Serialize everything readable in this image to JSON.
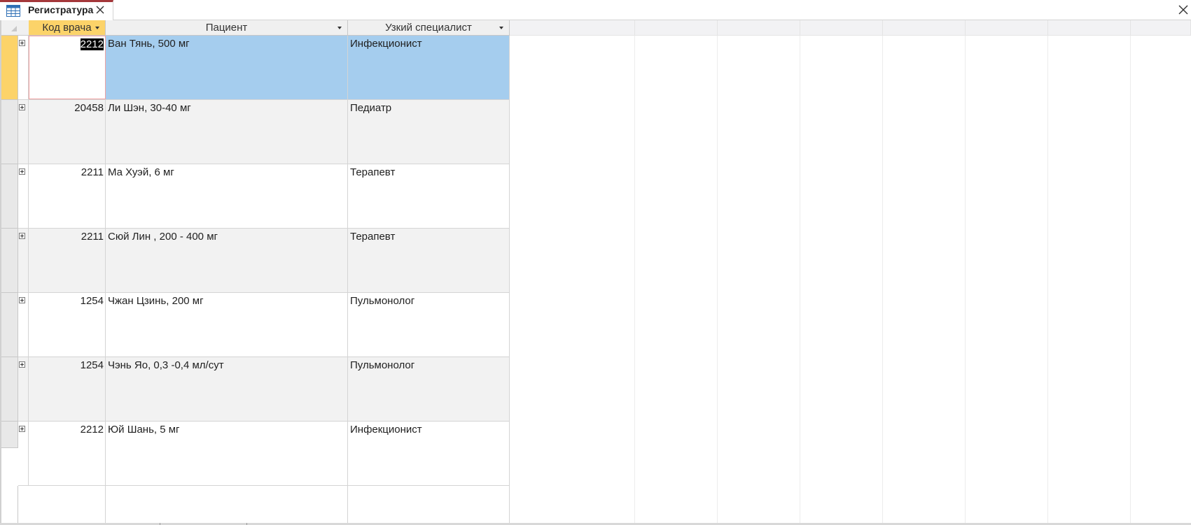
{
  "tab": {
    "title": "Регистратура",
    "icon": "table-icon",
    "close_icon": "close-icon"
  },
  "window": {
    "close_icon": "close-icon"
  },
  "columns": {
    "code": "Код врача",
    "patient": "Пациент",
    "specialist": "Узкий специалист"
  },
  "rows": [
    {
      "code": "2212",
      "patient": "Ван Тянь, 500 мг",
      "specialist": "Инфекционист"
    },
    {
      "code": "20458",
      "patient": "Ли Шэн, 30-40 мг",
      "specialist": "Педиатр"
    },
    {
      "code": "2211",
      "patient": "Ма Хуэй, 6 мг",
      "specialist": "Терапевт"
    },
    {
      "code": "2211",
      "patient": "Сюй Лин , 200 - 400 мг",
      "specialist": "Терапевт"
    },
    {
      "code": "1254",
      "patient": "Чжан Цзинь, 200 мг",
      "specialist": "Пульмонолог"
    },
    {
      "code": "1254",
      "patient": "Чэнь Яо, 0,3 -0,4 мл/сут",
      "specialist": "Пульмонолог"
    },
    {
      "code": "2212",
      "patient": "Юй Шань, 5 мг",
      "specialist": "Инфекционист"
    }
  ],
  "selected_row": 0,
  "colors": {
    "accent": "#a4373a",
    "active_header": "#fcd369",
    "selection": "#a5cdee"
  }
}
